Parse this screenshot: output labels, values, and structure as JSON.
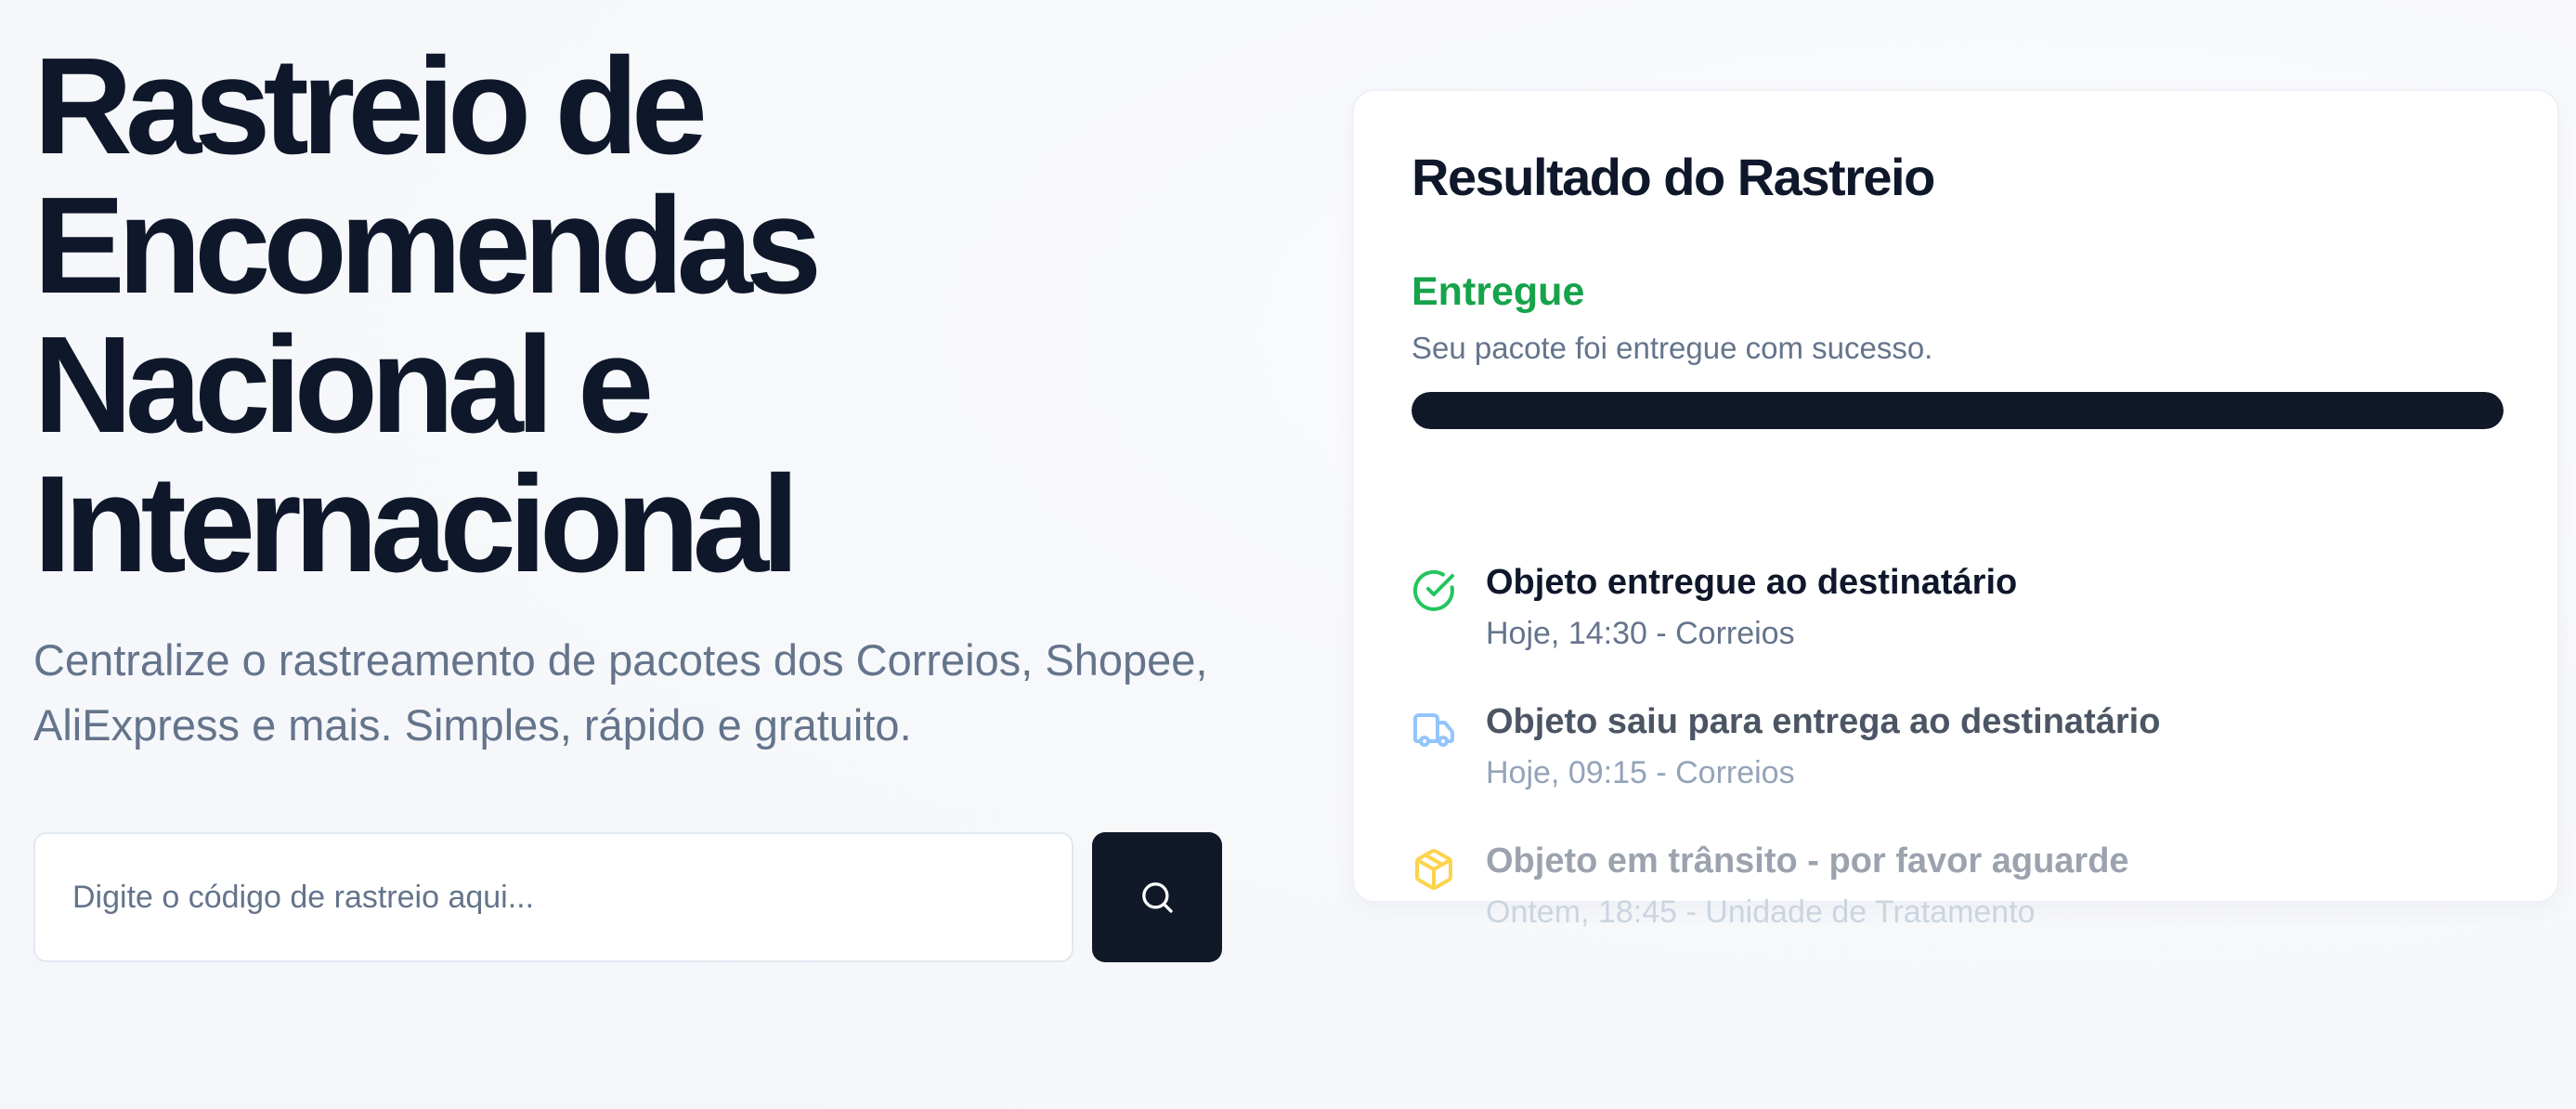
{
  "hero": {
    "title_lines": [
      "Rastreio de",
      "Encomendas",
      "Nacional e",
      "Internacional"
    ],
    "subtitle_line1": "Centralize o rastreamento de pacotes dos Correios, Shopee,",
    "subtitle_line2": "AliExpress e mais. Simples, rápido e gratuito."
  },
  "search": {
    "placeholder": "Digite o código de rastreio aqui...",
    "button_icon": "search-icon"
  },
  "result": {
    "title": "Resultado do Rastreio",
    "status": "Entregue",
    "status_description": "Seu pacote foi entregue com sucesso.",
    "progress": 1.0,
    "events": [
      {
        "icon": "check-circle-icon",
        "title": "Objeto entregue ao destinatário",
        "meta": "Hoje, 14:30 - Correios"
      },
      {
        "icon": "truck-icon",
        "title": "Objeto saiu para entrega ao destinatário",
        "meta": "Hoje, 09:15 - Correios"
      },
      {
        "icon": "package-icon",
        "title": "Objeto em trânsito - por favor aguarde",
        "meta": "Ontem, 18:45 - Unidade de Tratamento"
      }
    ]
  },
  "colors": {
    "heading": "#0f172a",
    "muted": "#64748b",
    "success": "#16a34a",
    "dark_button": "#111827",
    "truck_icon": "#93c5fd",
    "package_icon": "#fcd34d"
  }
}
